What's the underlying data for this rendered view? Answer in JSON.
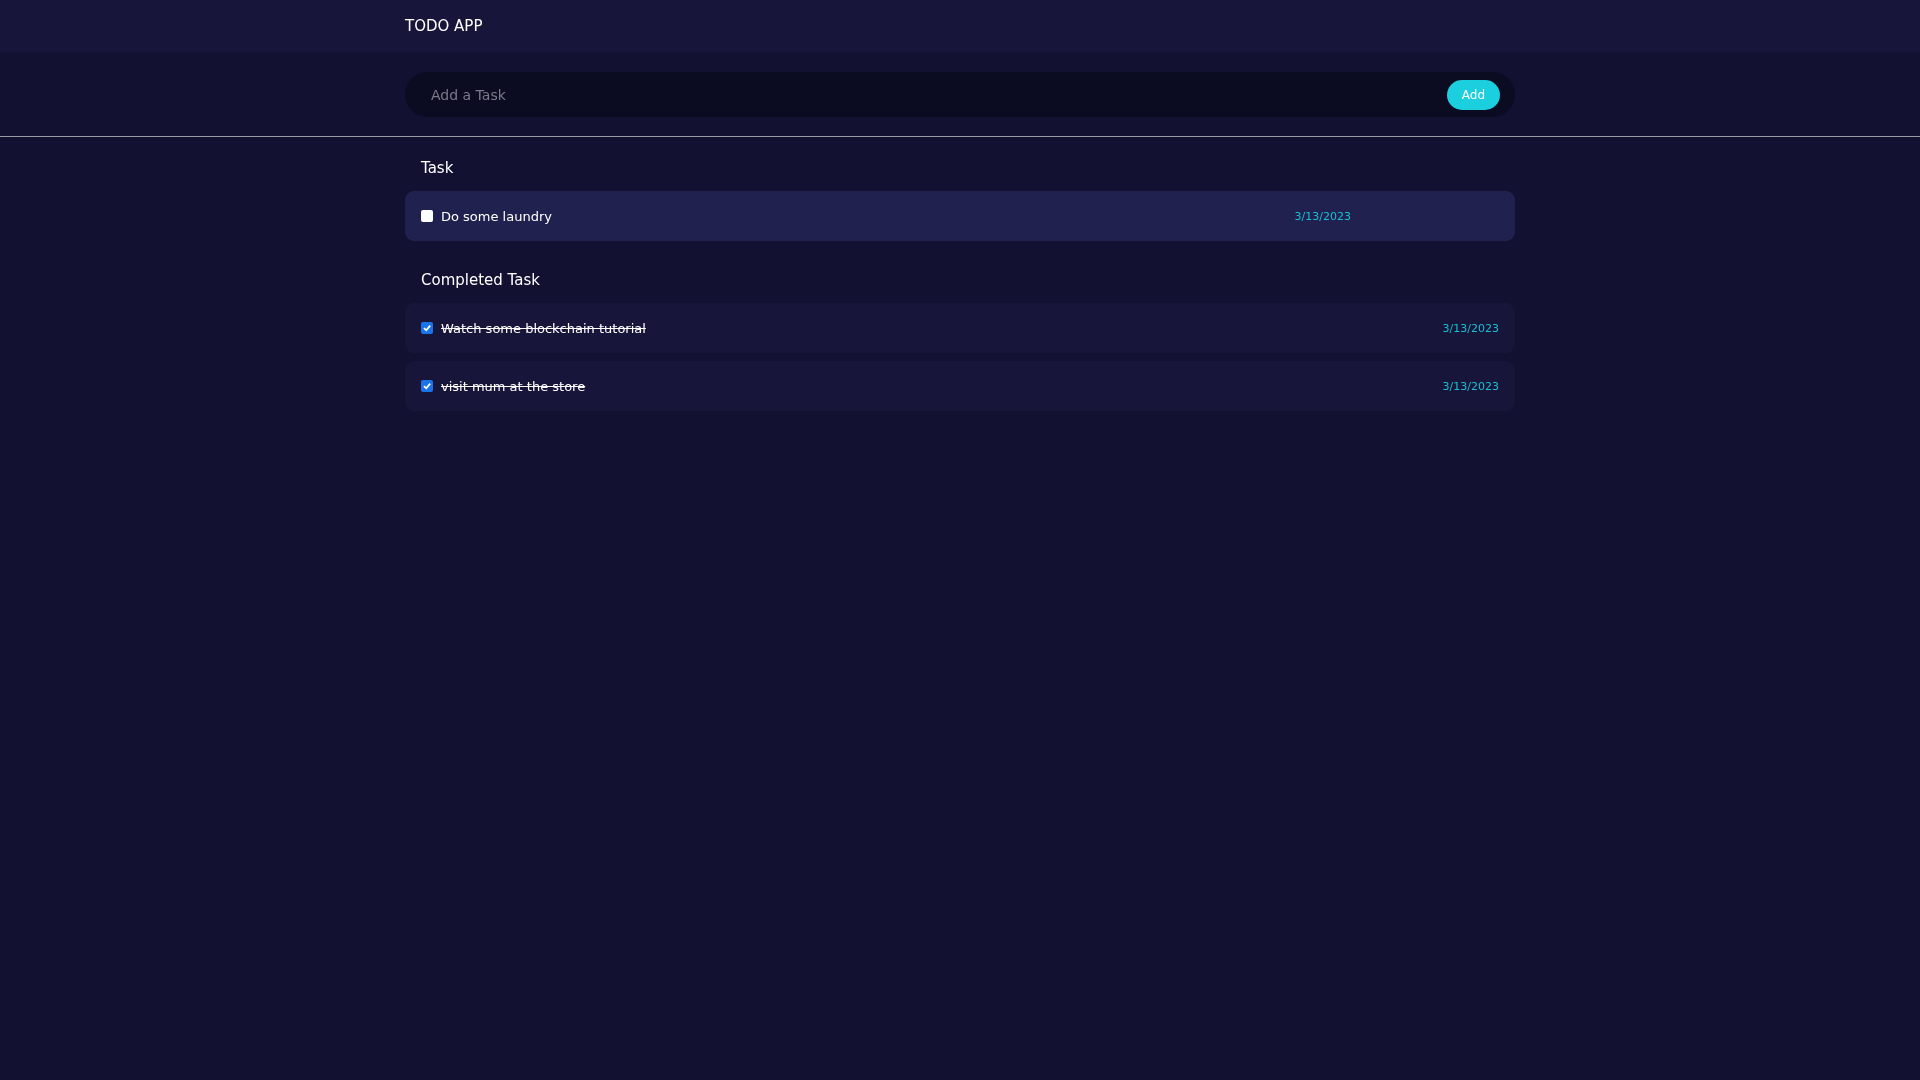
{
  "header": {
    "title": "TODO APP"
  },
  "new_task": {
    "placeholder": "Add a Task",
    "button": "Add"
  },
  "sections": [
    {
      "title": "Task",
      "tasks": [
        {
          "label": "Do some laundry",
          "checked": false,
          "date": "3/13/2023"
        }
      ]
    },
    {
      "title": "Completed Task",
      "tasks": [
        {
          "label": "Watch some blockchain tutorial",
          "checked": true,
          "date": "3/13/2023"
        },
        {
          "label": "visit mum at the store",
          "checked": true,
          "date": "3/13/2023"
        }
      ]
    }
  ]
}
